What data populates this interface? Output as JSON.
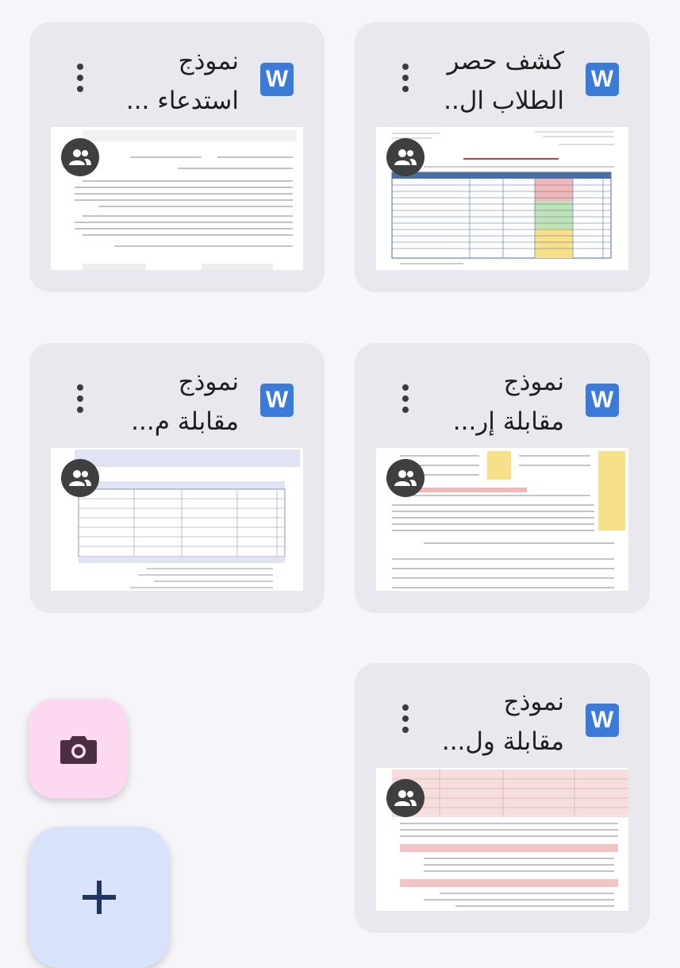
{
  "files": [
    {
      "title": "كشف حصر\nالطلاب ال..",
      "type_icon": "W",
      "shared_icon": "people-icon",
      "preview": "table"
    },
    {
      "title": "نموذج\nاستدعاء ...",
      "type_icon": "W",
      "shared_icon": "people-icon",
      "preview": "letter"
    },
    {
      "title": "نموذج\nمقابلة إر...",
      "type_icon": "W",
      "shared_icon": "people-icon",
      "preview": "form-yellow"
    },
    {
      "title": "نموذج\nمقابلة م...",
      "type_icon": "W",
      "shared_icon": "people-icon",
      "preview": "form-blue"
    },
    {
      "title": "نموذج\nمقابلة ول...",
      "type_icon": "W",
      "shared_icon": "people-icon",
      "preview": "form-pink"
    }
  ],
  "fab": {
    "camera_icon": "camera-icon",
    "add_icon": "plus-icon"
  },
  "colors": {
    "word_blue": "#3a7bd9",
    "card_bg": "#e8e8ee",
    "camera_fab": "#fcd8f1",
    "add_fab": "#d8e2fa"
  }
}
